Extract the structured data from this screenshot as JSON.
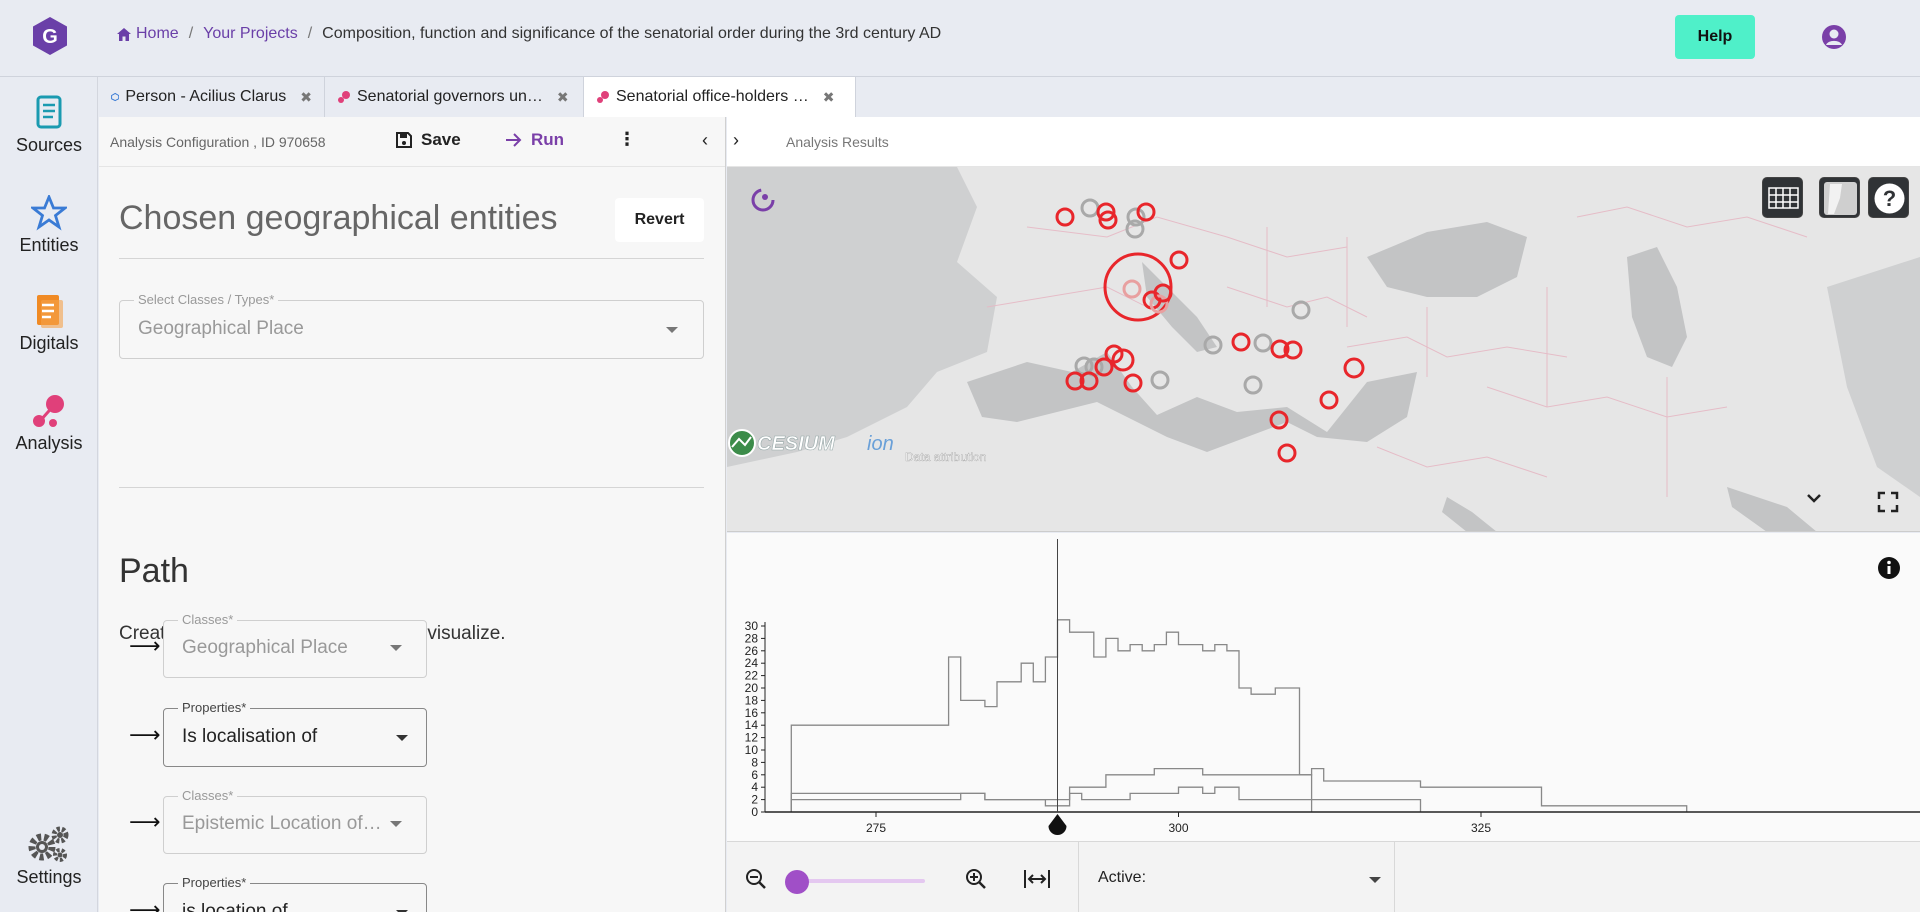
{
  "header": {
    "breadcrumb": {
      "home": "Home",
      "projects": "Your Projects",
      "current": "Composition, function and significance of the senatorial order during the 3rd century AD"
    },
    "help_label": "Help"
  },
  "nav": {
    "sources": "Sources",
    "entities": "Entities",
    "digitals": "Digitals",
    "analysis": "Analysis",
    "settings": "Settings"
  },
  "tabs": [
    {
      "label": "Person - Acilius Clarus",
      "icon": "person-icon"
    },
    {
      "label": "Senatorial governors un…",
      "icon": "analysis-icon"
    },
    {
      "label": "Senatorial office-holders …",
      "icon": "analysis-icon"
    }
  ],
  "config": {
    "title": "Analysis Configuration , ID 970658",
    "save_label": "Save",
    "run_label": "Run",
    "section_title": "Chosen geographical entities",
    "revert_label": "Revert",
    "select_classes": {
      "label": "Select Classes / Types*",
      "value": "Geographical Place"
    },
    "path_title": "Path",
    "path_desc": "Create a path to a class you want to visualize.",
    "path_rows": [
      {
        "label": "Classes*",
        "value": "Geographical Place",
        "enabled": false
      },
      {
        "label": "Properties*",
        "value": "Is localisation of",
        "enabled": true
      },
      {
        "label": "Classes*",
        "value": "Epistemic Location of…",
        "enabled": false
      },
      {
        "label": "Properties*",
        "value": "is location of",
        "enabled": true
      }
    ]
  },
  "results": {
    "title": "Analysis Results",
    "map_attribution": "Data attribution",
    "cesium_label": "CESIUM",
    "ion_label": "ion",
    "active_label": "Active:"
  },
  "colors": {
    "accent": "#7a3fa8",
    "help": "#4ff0c9",
    "marker_red": "#e8262b",
    "marker_grey": "#a9a9a9"
  },
  "chart_data": {
    "type": "line",
    "x_ticks": [
      275,
      300,
      325
    ],
    "y_ticks": [
      0,
      2,
      4,
      6,
      8,
      10,
      12,
      14,
      16,
      18,
      20,
      22,
      24,
      26,
      28,
      30
    ],
    "cursor_x": 290,
    "series": [
      {
        "x": [
          268,
          280,
          281,
          282,
          284,
          285,
          287,
          288,
          289,
          290,
          291,
          292,
          293,
          294,
          295,
          296,
          297,
          298,
          299,
          300,
          301,
          302,
          303,
          304,
          305,
          306,
          308,
          310,
          311,
          312,
          320,
          330,
          342
        ],
        "y": [
          14,
          14,
          25,
          18,
          17,
          21,
          24,
          21,
          25,
          31,
          29,
          29,
          25,
          28,
          26,
          27,
          26,
          27,
          29,
          27,
          27,
          26,
          27,
          26,
          20,
          19,
          20,
          6,
          7,
          5,
          4,
          1,
          0
        ]
      },
      {
        "x": [
          268,
          282,
          284,
          289,
          291,
          294,
          297,
          298,
          301,
          302,
          306,
          311,
          320
        ],
        "y": [
          3,
          3,
          2,
          2,
          4,
          6,
          6,
          7,
          7,
          6,
          6,
          2,
          0
        ]
      },
      {
        "x": [
          268,
          276,
          282,
          284,
          289,
          291,
          292,
          296,
          300,
          302,
          303,
          305,
          306,
          311
        ],
        "y": [
          2,
          2,
          3,
          2,
          1,
          3,
          2,
          3,
          4,
          3,
          4,
          2,
          2,
          0
        ]
      }
    ]
  }
}
